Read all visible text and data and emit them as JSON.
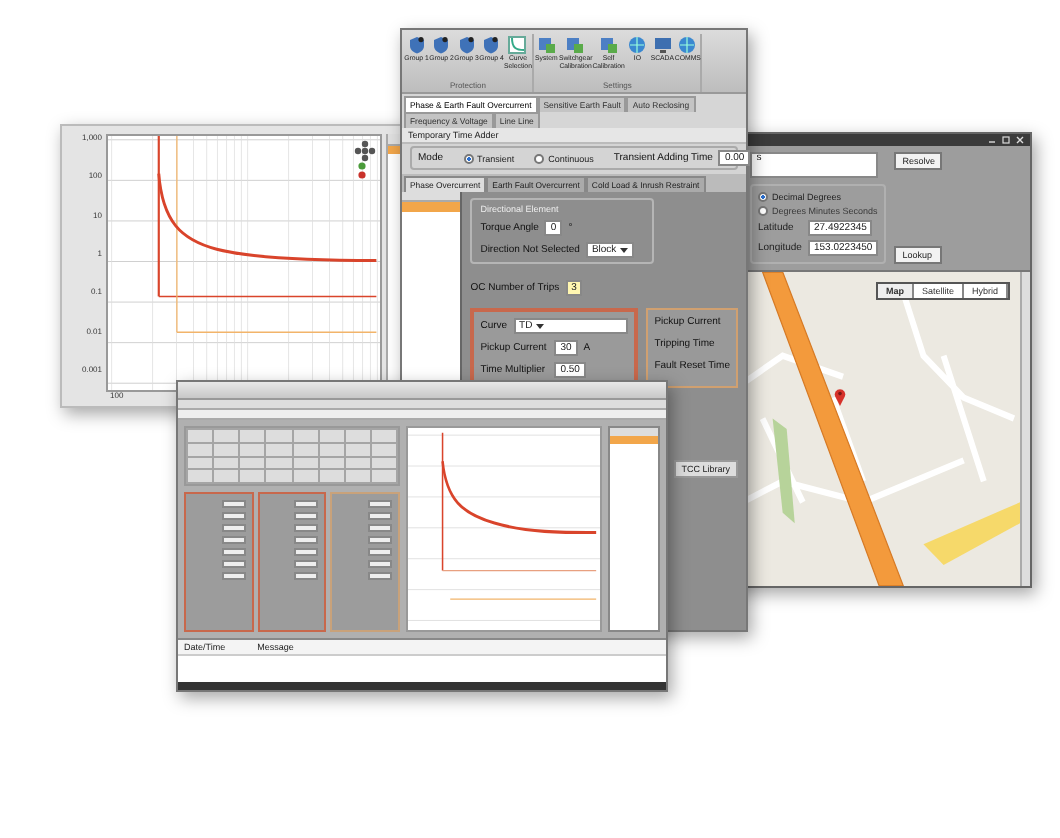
{
  "chart_window": {
    "y_ticks": [
      "1,000",
      "100",
      "10",
      "1",
      "0.1",
      "0.01",
      "0.001"
    ],
    "x_ticks": [
      "100"
    ]
  },
  "settings_window": {
    "toolbar_groups": [
      {
        "label": "Protection",
        "buttons": [
          {
            "label": "Group 1",
            "kind": "shield"
          },
          {
            "label": "Group 2",
            "kind": "shield"
          },
          {
            "label": "Group 3",
            "kind": "shield"
          },
          {
            "label": "Group 4",
            "kind": "shield"
          },
          {
            "label": "Curve Selection",
            "kind": "curve"
          }
        ]
      },
      {
        "label": "Settings",
        "buttons": [
          {
            "label": "System",
            "kind": "device"
          },
          {
            "label": "Switchgear Calibration",
            "kind": "device"
          },
          {
            "label": "Self Calibration",
            "kind": "device"
          },
          {
            "label": "IO",
            "kind": "globe"
          },
          {
            "label": "SCADA",
            "kind": "monitor"
          },
          {
            "label": "COMMS",
            "kind": "globe"
          }
        ]
      }
    ],
    "tabs": [
      {
        "label": "Phase & Earth Fault Overcurrent",
        "selected": true
      },
      {
        "label": "Sensitive Earth Fault",
        "selected": false
      },
      {
        "label": "Auto Reclosing",
        "selected": false
      },
      {
        "label": "Frequency & Voltage",
        "selected": false
      },
      {
        "label": "Line Line",
        "selected": false
      }
    ],
    "section": "Temporary Time Adder",
    "mode_label": "Mode",
    "modes": [
      {
        "label": "Transient",
        "selected": true
      },
      {
        "label": "Continuous",
        "selected": false
      }
    ],
    "adding_time": {
      "label": "Transient Adding Time",
      "value": "0.00",
      "unit": "s"
    },
    "sub_tabs": [
      {
        "label": "Phase Overcurrent",
        "selected": true
      },
      {
        "label": "Earth Fault Overcurrent",
        "selected": false
      },
      {
        "label": "Cold Load & Inrush Restraint",
        "selected": false
      }
    ],
    "directional": {
      "title": "Directional Element",
      "torque_label": "Torque Angle",
      "torque_value": "0",
      "torque_unit": "°",
      "direction_label": "Direction Not Selected",
      "direction_value": "Block"
    },
    "trips": {
      "label": "OC Number of Trips",
      "value": "3"
    },
    "curve_panel": {
      "curve_label": "Curve",
      "curve_value": "TD",
      "rows": [
        {
          "label": "Pickup Current",
          "value": "30",
          "unit": "A"
        },
        {
          "label": "Time Multiplier",
          "value": "0.50",
          "unit": ""
        }
      ]
    },
    "result_labels": [
      "Pickup Current",
      "Tripping Time",
      "Fault Reset Time"
    ],
    "library_tab": "TCC Library"
  },
  "map_window": {
    "resolve": "Resolve",
    "degree_modes": [
      {
        "label": "Decimal Degrees",
        "selected": true
      },
      {
        "label": "Degrees Minutes Seconds",
        "selected": false
      }
    ],
    "coordinates": [
      {
        "label": "Latitude",
        "value": "27.4922345"
      },
      {
        "label": "Longitude",
        "value": "153.0223450"
      }
    ],
    "lookup": "Lookup",
    "map_types": [
      {
        "label": "Map",
        "selected": true
      },
      {
        "label": "Satellite",
        "selected": false
      },
      {
        "label": "Hybrid",
        "selected": false
      }
    ]
  },
  "editor_window": {
    "log_columns": [
      "Date/Time",
      "Message"
    ]
  }
}
